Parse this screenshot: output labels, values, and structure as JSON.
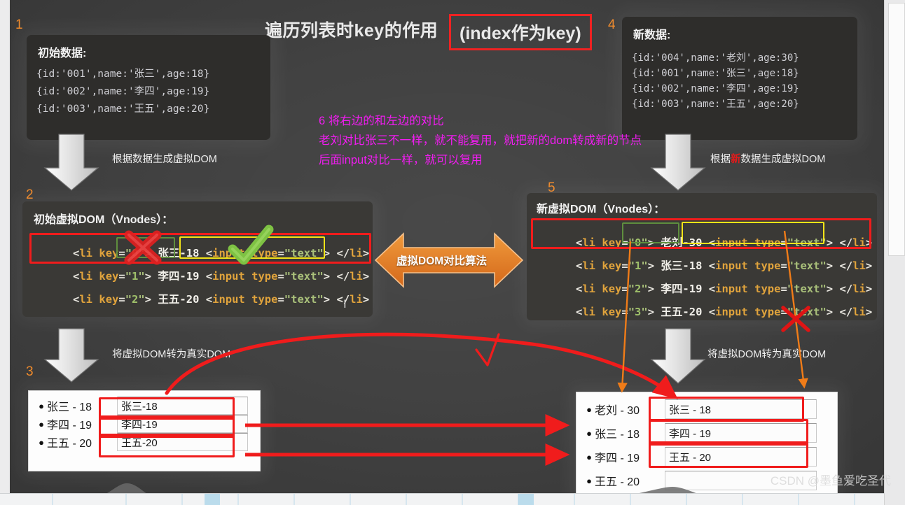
{
  "title": {
    "main": "遍历列表时key的作用",
    "boxed": "(index作为key)"
  },
  "steps": {
    "s1": "1",
    "s2": "2",
    "s3": "3",
    "s4": "4",
    "s5": "5",
    "s6": "6"
  },
  "initial_data": {
    "heading": "初始数据:",
    "lines": [
      "{id:'001',name:'张三',age:18}",
      "{id:'002',name:'李四',age:19}",
      "{id:'003',name:'王五',age:20}"
    ]
  },
  "new_data": {
    "heading": "新数据:",
    "lines": [
      "{id:'004',name:'老刘',age:30}",
      "{id:'001',name:'张三',age:18}",
      "{id:'002',name:'李四',age:19}",
      "{id:'003',name:'王五',age:20}"
    ]
  },
  "old_vnodes": {
    "heading": "初始虚拟DOM（Vnodes）：",
    "lines": [
      {
        "key": "0",
        "text": "张三-18",
        "input": "<input type=\"text\">"
      },
      {
        "key": "1",
        "text": "李四-19",
        "input": "<input type=\"text\">"
      },
      {
        "key": "2",
        "text": "王五-20",
        "input": "<input type=\"text\">"
      }
    ]
  },
  "new_vnodes": {
    "heading": "新虚拟DOM（Vnodes）：",
    "lines": [
      {
        "key": "0",
        "text": "老刘-30",
        "input": "<input type=\"text\">"
      },
      {
        "key": "1",
        "text": "张三-18",
        "input": "<input type=\"text\">"
      },
      {
        "key": "2",
        "text": "李四-19",
        "input": "<input type=\"text\">"
      },
      {
        "key": "3",
        "text": "王五-20",
        "input": "<input type=\"text\">"
      }
    ]
  },
  "arrow_labels": {
    "gen_vdom_left": "根据数据生成虚拟DOM",
    "gen_vdom_right_pre": "根据",
    "gen_vdom_right_hl": "新",
    "gen_vdom_right_post": "数据生成虚拟DOM",
    "to_real_left": "将虚拟DOM转为真实DOM",
    "to_real_right": "将虚拟DOM转为真实DOM",
    "diff_algorithm": "虚拟DOM对比算法"
  },
  "note": {
    "line1": "6 将右边的和左边的对比",
    "line2": "老刘对比张三不一样，就不能复用，就把新的dom转成新的节点",
    "line3": "后面input对比一样，就可以复用"
  },
  "old_real_dom": {
    "rows": [
      {
        "label": "张三 - 18",
        "input": "张三-18"
      },
      {
        "label": "李四 - 19",
        "input": "李四-19"
      },
      {
        "label": "王五 - 20",
        "input": "王五-20"
      }
    ]
  },
  "new_real_dom": {
    "rows": [
      {
        "label": "老刘 - 30",
        "input": "张三 - 18"
      },
      {
        "label": "张三 - 18",
        "input": "李四 - 19"
      },
      {
        "label": "李四 - 19",
        "input": "王五 - 20"
      },
      {
        "label": "王五 - 20",
        "input": ""
      }
    ]
  },
  "watermark": "CSDN @墨鱼爱吃圣代",
  "colors": {
    "slide_bg": "#3e3e3e",
    "code_panel": "#2e2d2b",
    "vnode_panel": "#3a3936",
    "accent_red": "#f01c1c",
    "accent_orange": "#ef8a2b",
    "accent_magenta": "#f21cf2",
    "accent_yellow": "#f2e318",
    "accent_green": "#5f8e3e"
  }
}
